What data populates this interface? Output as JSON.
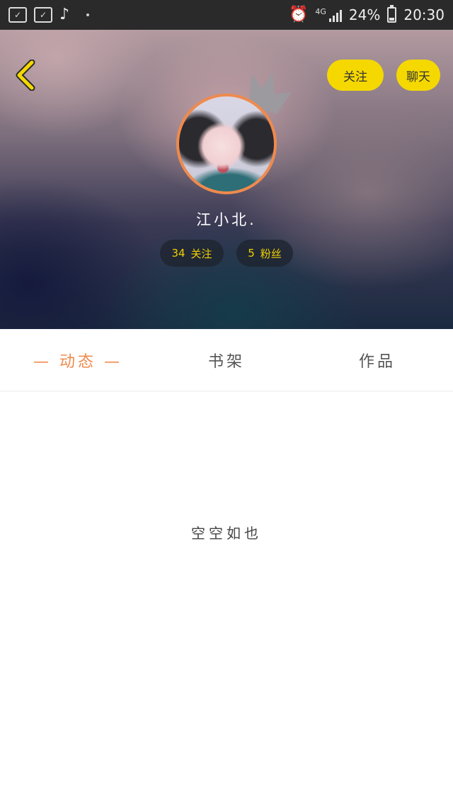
{
  "status_bar": {
    "left_icons": [
      "sim-card-icon",
      "sim-card-icon",
      "tiktok-icon",
      "dot-icon"
    ],
    "network_label": "4G",
    "battery_text": "24%",
    "time": "20:30",
    "battery_level": 0.24
  },
  "header": {
    "follow_button": "关注",
    "chat_button": "聊天",
    "username": "江小北.",
    "following_count": "34",
    "following_label": "关注",
    "fans_count": "5",
    "fans_label": "粉丝"
  },
  "tabs": [
    {
      "label": "— 动态 —",
      "active": true
    },
    {
      "label": "书架",
      "active": false
    },
    {
      "label": "作品",
      "active": false
    }
  ],
  "content": {
    "empty_text": "空空如也"
  },
  "colors": {
    "accent": "#ef8a4d",
    "button_yellow": "#f5d800",
    "stat_text": "#f2d000"
  },
  "icons": {
    "back": "chevron-left-icon",
    "crown": "crown-icon",
    "alarm": "alarm-icon",
    "signal": "signal-icon",
    "battery": "battery-icon"
  }
}
